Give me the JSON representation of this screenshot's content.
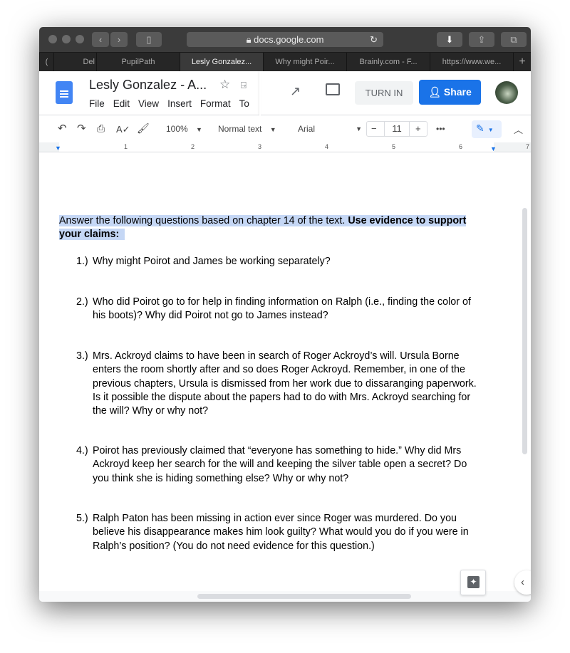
{
  "browser": {
    "url": "docs.google.com",
    "tabs": [
      {
        "label": "("
      },
      {
        "label": "Del"
      },
      {
        "label": "PupilPath"
      },
      {
        "label": "Lesly Gonzalez..."
      },
      {
        "label": "Why might Poir..."
      },
      {
        "label": "Brainly.com - F..."
      },
      {
        "label": "https://www.we..."
      }
    ],
    "new_tab": "+"
  },
  "doc": {
    "title": "Lesly Gonzalez - A...",
    "menu": [
      "File",
      "Edit",
      "View",
      "Insert",
      "Format",
      "To"
    ],
    "turn_in": "TURN IN",
    "share": "Share"
  },
  "toolbar": {
    "zoom": "100%",
    "style": "Normal text",
    "font": "Arial",
    "font_size": "11",
    "more": "•••"
  },
  "ruler": [
    "1",
    "2",
    "3",
    "4",
    "5",
    "6",
    "7"
  ],
  "content": {
    "intro": "Answer the following questions based on chapter 14 of the text. ",
    "intro_bold_1": "Use evidence to support",
    "intro_bold_2": "your claims:",
    "questions": [
      {
        "num": "1.)",
        "lines": [
          "Why might Poirot and James be working separately?"
        ]
      },
      {
        "num": "2.)",
        "lines": [
          "Who did Poirot go to for help in finding information on Ralph (i.e., finding the color of",
          "his boots)? Why did Poirot not go to James instead?"
        ]
      },
      {
        "num": "3.)",
        "lines": [
          "Mrs. Ackroyd claims to have been in search of Roger Ackroyd’s will. Ursula Borne",
          "enters the room shortly after and so does Roger Ackroyd. Remember, in one of the",
          "previous chapters, Ursula is dismissed from her work due to dissaranging paperwork.",
          "Is it possible the dispute about the papers had to do with Mrs. Ackroyd searching for",
          "the will? Why or why not?"
        ]
      },
      {
        "num": "4.)",
        "lines": [
          "Poirot has previously claimed that “everyone has something to hide.” Why did Mrs",
          "Ackroyd keep her search for the will and keeping the silver table open a secret? Do",
          "you think she is hiding something else? Why or why not?"
        ]
      },
      {
        "num": "5.)",
        "lines": [
          "Ralph Paton has been missing in action ever since Roger was murdered. Do you",
          "believe his disappearance makes him look guilty? What would you do if you were in",
          "Ralph’s position? (You do not need evidence for this question.)"
        ]
      }
    ]
  },
  "colors": {
    "accent": "#1a73e8",
    "selection": "#c5d7f5"
  }
}
